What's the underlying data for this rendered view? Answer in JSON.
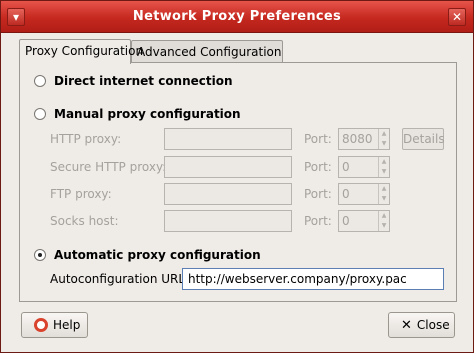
{
  "window": {
    "title": "Network Proxy Preferences"
  },
  "tabs": [
    {
      "label": "Proxy Configuration",
      "active": true
    },
    {
      "label": "Advanced Configuration",
      "active": false
    }
  ],
  "options": {
    "direct": "Direct internet connection",
    "manual": "Manual proxy configuration",
    "automatic": "Automatic proxy configuration",
    "selected": "automatic"
  },
  "manual_fields": [
    {
      "label": "HTTP proxy:",
      "value": "",
      "port": "8080"
    },
    {
      "label": "Secure HTTP proxy:",
      "value": "",
      "port": "0"
    },
    {
      "label": "FTP proxy:",
      "value": "",
      "port": "0"
    },
    {
      "label": "Socks host:",
      "value": "",
      "port": "0"
    }
  ],
  "port_label": "Port:",
  "details_label": "Details",
  "autoconfig": {
    "label": "Autoconfiguration URL:",
    "value": "http://webserver.company/proxy.pac"
  },
  "buttons": {
    "help": "Help",
    "close": "Close"
  }
}
